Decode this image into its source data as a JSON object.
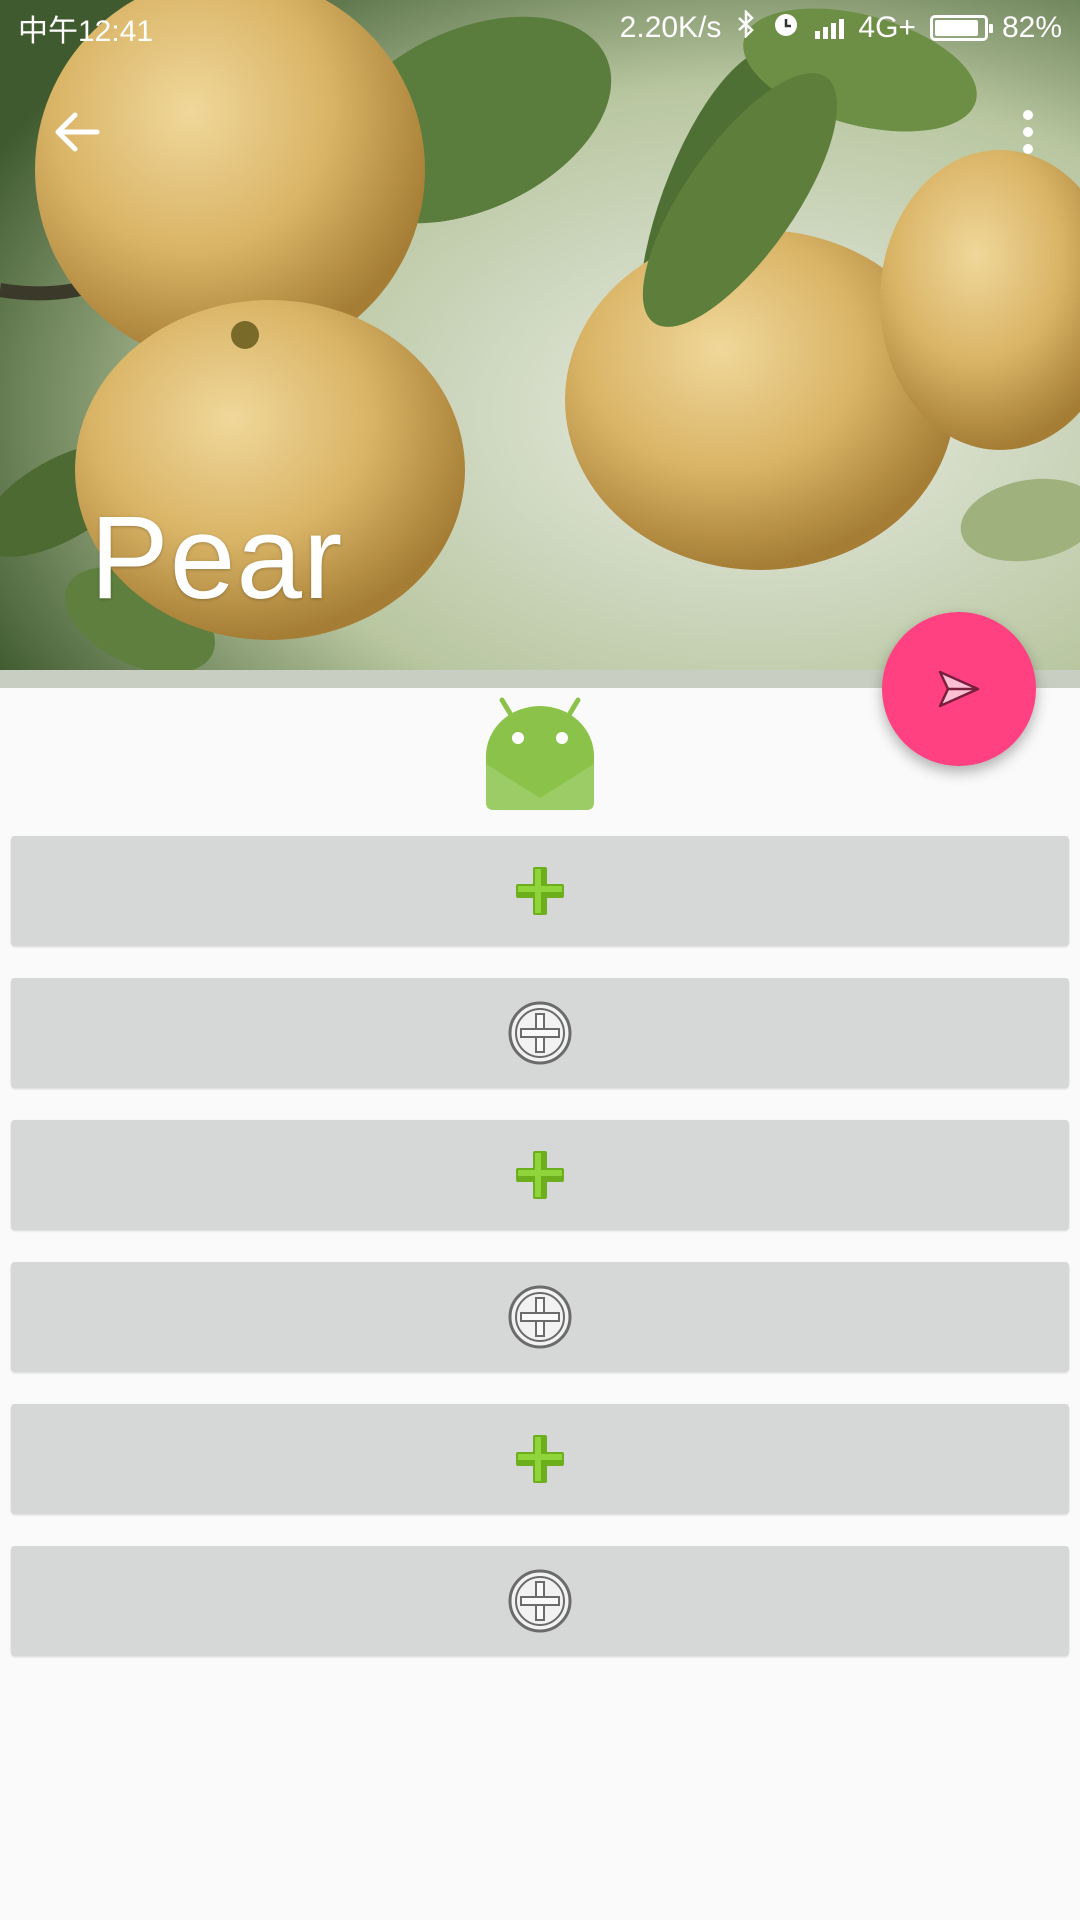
{
  "status_bar": {
    "time": "中午12:41",
    "network_speed": "2.20K/s",
    "network_type": "4G+",
    "battery_percent": "82%",
    "battery_level": 0.82
  },
  "header": {
    "title": "Pear",
    "back_icon": "arrow-back-icon",
    "menu_icon": "more-vert-icon",
    "image": "pear-photo"
  },
  "fab": {
    "icon": "send-icon",
    "color": "#ff4081"
  },
  "content": {
    "logo_icon": "android-icon",
    "buttons": [
      {
        "icon": "green-plus-icon"
      },
      {
        "icon": "circle-plus-icon"
      },
      {
        "icon": "green-plus-icon"
      },
      {
        "icon": "circle-plus-icon"
      },
      {
        "icon": "green-plus-icon"
      },
      {
        "icon": "circle-plus-icon"
      }
    ]
  },
  "colors": {
    "accent": "#ff4081",
    "button_bg": "#d6d7d7",
    "page_bg": "#fafafa",
    "android_green": "#8bc34a"
  }
}
